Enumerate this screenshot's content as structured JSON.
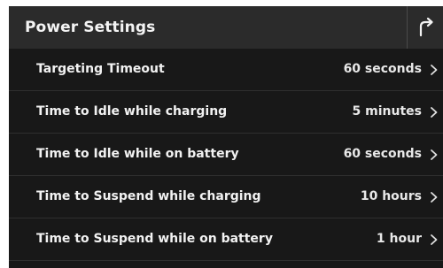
{
  "header": {
    "title": "Power Settings",
    "back_icon": "return-arrow-icon"
  },
  "settings": [
    {
      "label": "Targeting Timeout",
      "value": "60 seconds"
    },
    {
      "label": "Time to Idle while charging",
      "value": "5 minutes"
    },
    {
      "label": "Time to Idle while on battery",
      "value": "60 seconds"
    },
    {
      "label": "Time to Suspend while charging",
      "value": "10 hours"
    },
    {
      "label": "Time to Suspend while on battery",
      "value": "1 hour"
    }
  ],
  "colors": {
    "background": "#181818",
    "header": "#2b2b2b",
    "text": "#f2f2f2"
  }
}
